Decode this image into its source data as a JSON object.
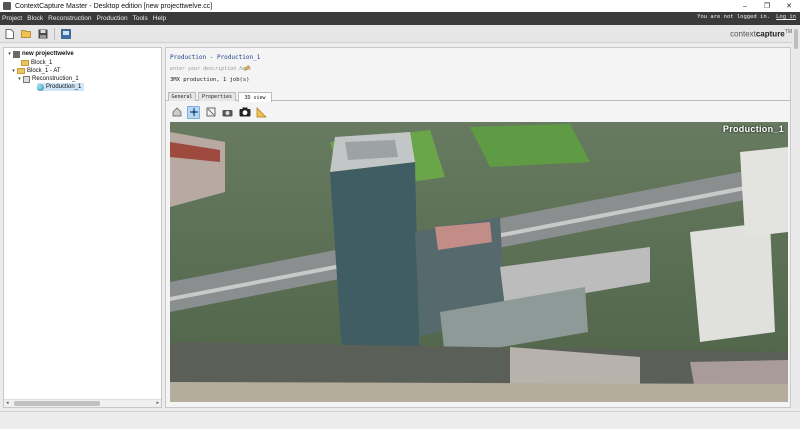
{
  "window": {
    "title": "ContextCapture Master - Desktop edition [new projecttwelve.cc]",
    "controls": [
      "–",
      "❐",
      "✕"
    ]
  },
  "menu": {
    "items": [
      "Project",
      "Block",
      "Reconstruction",
      "Production",
      "Tools",
      "Help"
    ],
    "login_status": "You are not logged in.",
    "login_link": "Log in"
  },
  "toolbar": {
    "icons": [
      "new-project-icon",
      "open-project-icon",
      "save-project-icon",
      "settings-icon"
    ],
    "brand_prefix": "context",
    "brand_suffix": "capture",
    "brand_tm": "TM"
  },
  "tree": {
    "items": [
      {
        "label": "new projecttwelve",
        "level": 0,
        "icon": "project-icon",
        "expanded": true
      },
      {
        "label": "Block_1",
        "level": 1,
        "icon": "folder-icon",
        "expanded": false
      },
      {
        "label": "Block_1 - AT",
        "level": 1,
        "icon": "folder-icon",
        "expanded": true
      },
      {
        "label": "Reconstruction_1",
        "level": 2,
        "icon": "reconstruction-icon",
        "expanded": true
      },
      {
        "label": "Production_1",
        "level": 3,
        "icon": "production-icon",
        "selected": true
      }
    ]
  },
  "production": {
    "title": "Production - Production_1",
    "description_placeholder": "enter your description here",
    "summary": "3MX production, 1 job(s)"
  },
  "tabs": [
    {
      "label": "General",
      "active": false
    },
    {
      "label": "Properties",
      "active": false
    },
    {
      "label": "3D view",
      "active": true
    }
  ],
  "view_toolbar": {
    "buttons": [
      "home-view-icon",
      "orbit-icon",
      "pan-icon",
      "snapshot-icon",
      "camera-icon",
      "measure-icon"
    ]
  },
  "viewport": {
    "label": "Production_1"
  },
  "colors": {
    "menubar": "#3a3a3a",
    "title_link": "#1a3f8a",
    "selection": "#cfe5f8"
  }
}
